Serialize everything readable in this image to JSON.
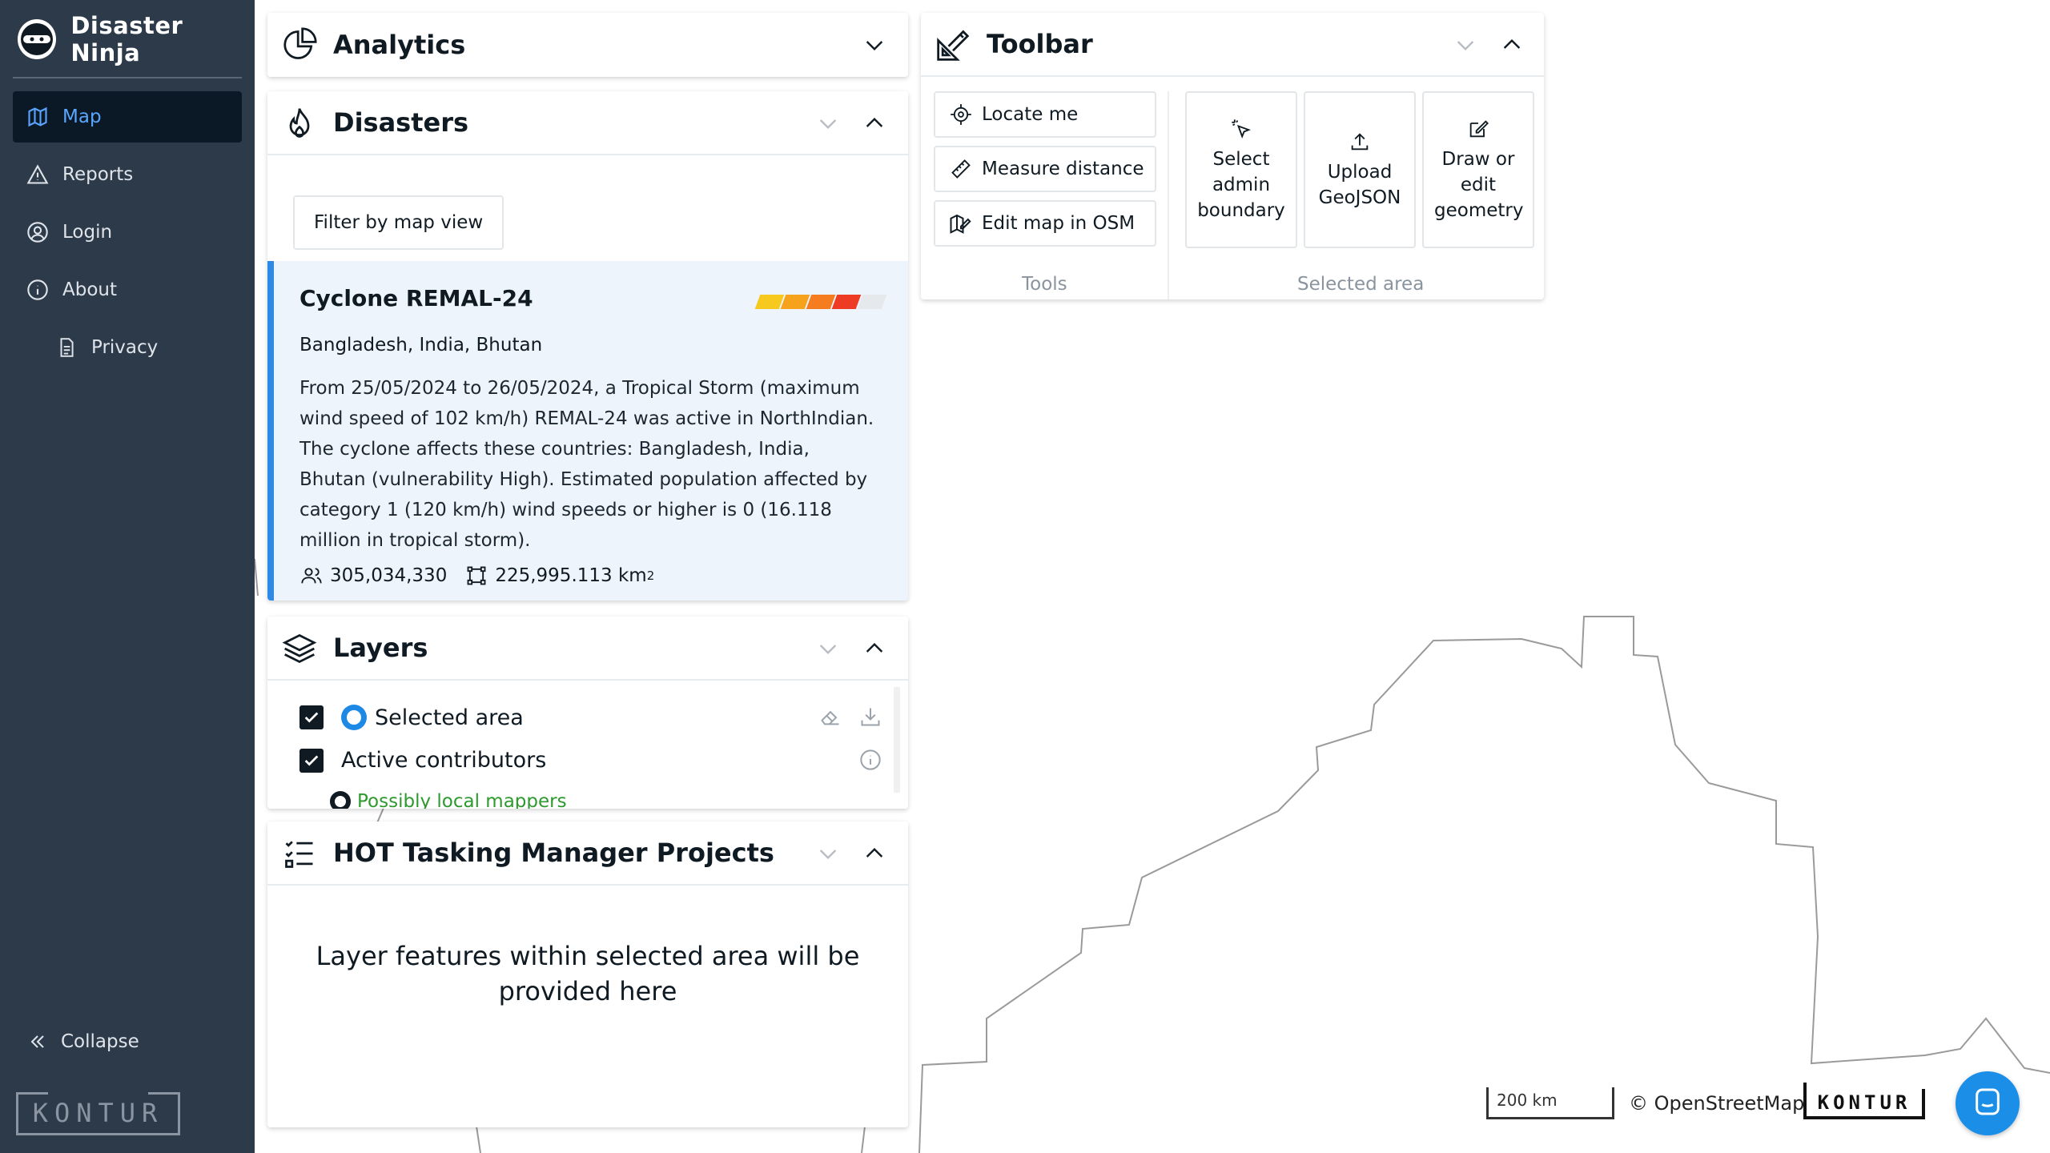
{
  "app": {
    "title": "Disaster Ninja"
  },
  "sidebar": {
    "items": [
      {
        "label": "Map",
        "icon": "map-icon",
        "active": true
      },
      {
        "label": "Reports",
        "icon": "warning-triangle-icon"
      },
      {
        "label": "Login",
        "icon": "user-circle-icon"
      },
      {
        "label": "About",
        "icon": "info-icon"
      },
      {
        "label": "Privacy",
        "icon": "document-icon"
      }
    ],
    "collapse_label": "Collapse",
    "footer_logo": "KONTUR"
  },
  "analytics": {
    "title": "Analytics"
  },
  "disasters": {
    "title": "Disasters",
    "filter_label": "Filter by map view",
    "event": {
      "title": "Cyclone REMAL-24",
      "countries": "Bangladesh, India, Bhutan",
      "description": "From 25/05/2024 to 26/05/2024, a Tropical Storm (maximum wind speed of 102 km/h) REMAL-24 was active in NorthIndian. The cyclone affects these countries: Bangladesh, India, Bhutan (vulnerability High). Estimated population affected by category 1 (120 km/h) wind speeds or higher is 0 (16.118 million in tropical storm).",
      "population": "305,034,330",
      "area": "225,995.113 km",
      "area_sup": "2",
      "severity_colors": [
        "#f7c81e",
        "#f6a21c",
        "#f57c1f",
        "#ee3b24",
        "#e6e9ec"
      ]
    }
  },
  "layers": {
    "title": "Layers",
    "items": [
      {
        "label": "Selected area",
        "checked": true
      },
      {
        "label": "Active contributors",
        "checked": true
      }
    ],
    "legend": {
      "label": "Possibly local mappers",
      "color": "#2e9a2e"
    }
  },
  "hot": {
    "title": "HOT Tasking Manager Projects",
    "empty_text": "Layer features within selected area will be provided here"
  },
  "toolbar": {
    "title": "Toolbar",
    "tools": [
      {
        "label": "Locate me",
        "icon": "crosshair-icon"
      },
      {
        "label": "Measure distance",
        "icon": "ruler-icon"
      },
      {
        "label": "Edit map in OSM",
        "icon": "map-edit-icon"
      }
    ],
    "tools_caption": "Tools",
    "selected_area": [
      {
        "label": "Select admin boundary",
        "icon": "cursor-click-icon"
      },
      {
        "label": "Upload GeoJSON",
        "icon": "upload-icon"
      },
      {
        "label": "Draw or edit geometry",
        "icon": "edit-square-icon"
      }
    ],
    "selected_caption": "Selected area"
  },
  "map": {
    "scale_label": "200 km",
    "attribution": "© OpenStreetMap",
    "logo": "KONTUR"
  },
  "colors": {
    "sidebar_bg": "#2d3a4a",
    "active_nav_bg": "#0b1826",
    "accent": "#2e8ae6",
    "event_card_bg": "#edf4fb"
  }
}
